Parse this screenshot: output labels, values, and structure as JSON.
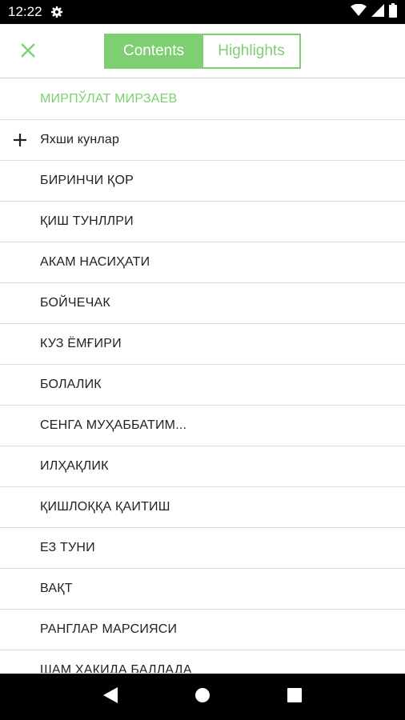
{
  "status": {
    "time": "12:22",
    "icons": [
      "gear-icon",
      "wifi-icon",
      "signal-icon",
      "battery-icon"
    ]
  },
  "toolbar": {
    "close_icon": "close-icon",
    "tabs": [
      {
        "label": "Contents",
        "active": true
      },
      {
        "label": "Highlights",
        "active": false
      }
    ]
  },
  "contents": {
    "title": "МИРПЎЛАТ МИРЗАЕВ",
    "items": [
      {
        "label": "Яхши кунлар",
        "expandable": true
      },
      {
        "label": "БИРИНЧИ ҚОР"
      },
      {
        "label": "ҚИШ ТУНЛЛРИ"
      },
      {
        "label": "АКАМ НАСИҲАТИ"
      },
      {
        "label": "БОЙЧЕЧАК"
      },
      {
        "label": "КУЗ ЁМҒИРИ"
      },
      {
        "label": "БОЛАЛИК"
      },
      {
        "label": "СЕНГА МУҲАББАТИМ..."
      },
      {
        "label": "ИЛҲАҚЛИК"
      },
      {
        "label": "ҚИШЛОҚҚА ҚАИТИШ"
      },
      {
        "label": "ЕЗ ТУНИ"
      },
      {
        "label": "ВАҚТ"
      },
      {
        "label": "РАНГЛАР МАРСИЯСИ"
      },
      {
        "label": "ШАМ ҲАҚИДА БАЛЛАДА"
      }
    ]
  },
  "colors": {
    "accent": "#7dcf72",
    "text": "#222222",
    "divider": "#dedede"
  },
  "nav": {
    "icons": [
      "back-icon",
      "home-icon",
      "recents-icon"
    ]
  }
}
